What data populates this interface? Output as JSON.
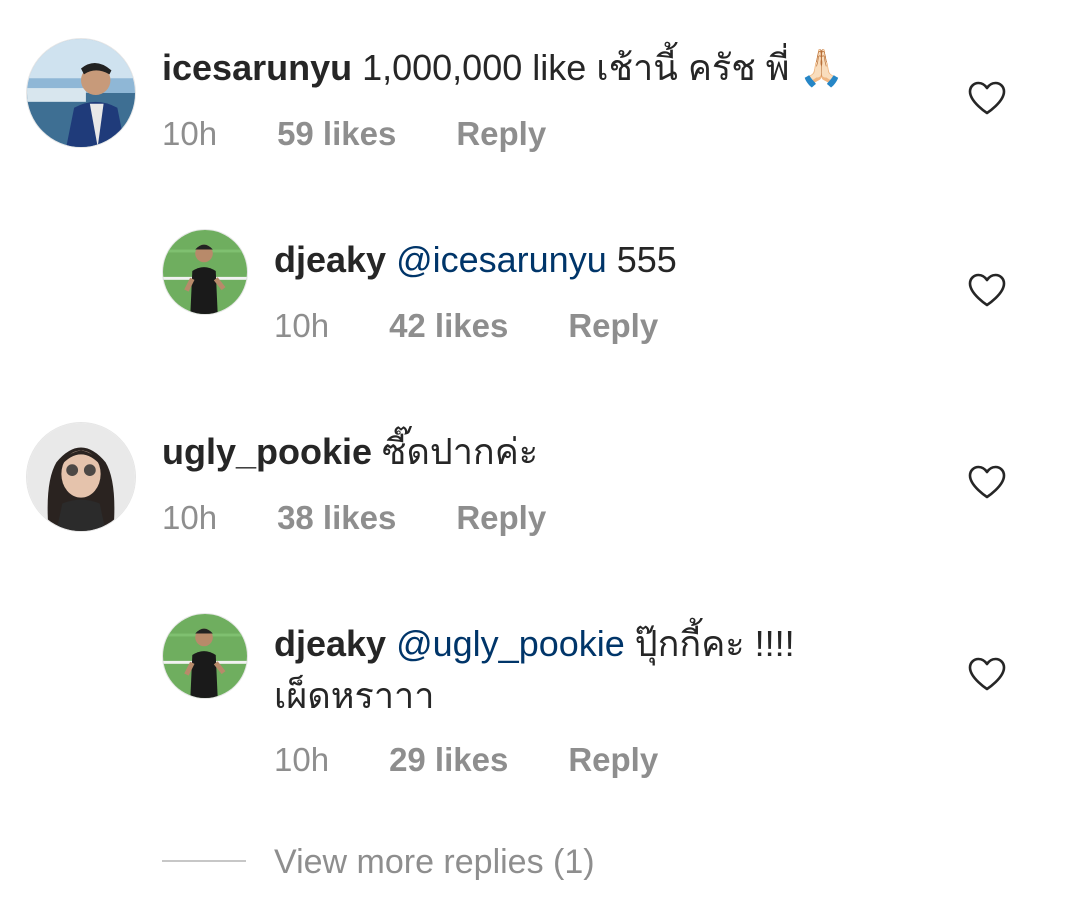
{
  "comments": [
    {
      "username": "icesarunyu",
      "mention": "",
      "text": " 1,000,000 like เช้านี้ ครัช พี่ ",
      "emoji": "🙏🏻",
      "text_line2": "",
      "time": "10h",
      "likes": "59 likes",
      "reply": "Reply",
      "heart_icon": "heart-outline-icon"
    },
    {
      "username": "djeaky",
      "mention": " @icesarunyu",
      "text": " 555",
      "emoji": "",
      "text_line2": "",
      "time": "10h",
      "likes": "42 likes",
      "reply": "Reply",
      "heart_icon": "heart-outline-icon"
    },
    {
      "username": "ugly_pookie",
      "mention": "",
      "text": " ซี๊ดปากค่ะ",
      "emoji": "",
      "text_line2": "",
      "time": "10h",
      "likes": "38 likes",
      "reply": "Reply",
      "heart_icon": "heart-outline-icon"
    },
    {
      "username": "djeaky",
      "mention": " @ugly_pookie",
      "text": " ปุ๊กกี้คะ !!!!",
      "emoji": "",
      "text_line2": "เผ็ดหราาา",
      "time": "10h",
      "likes": "29 likes",
      "reply": "Reply",
      "heart_icon": "heart-outline-icon"
    }
  ],
  "view_more": "View more replies (1)",
  "colors": {
    "text": "#262626",
    "meta": "#8e8e8e",
    "mention": "#003569",
    "divider": "#c7c7c7"
  }
}
